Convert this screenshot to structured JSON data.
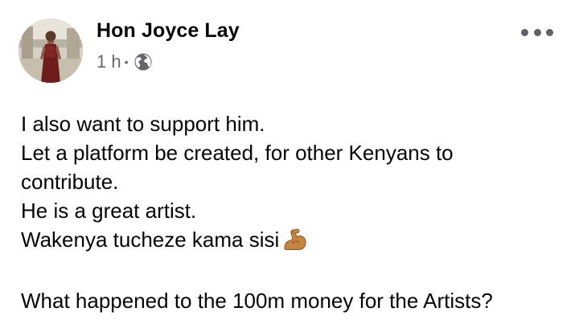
{
  "post": {
    "author": "Hon Joyce Lay",
    "time": "1 h",
    "separator": "•",
    "audience_icon": "globe-icon",
    "more_icon": "more-options-icon",
    "lines": [
      "I also want to support him.",
      "Let a platform be created, for other Kenyans to",
      "contribute.",
      "He is a great artist.",
      "Wakenya tucheze kama sisi"
    ],
    "emoji": "flexed-biceps-icon",
    "final_line": "What happened to the 100m money for the Artists?"
  },
  "colors": {
    "text": "#050505",
    "meta": "#65676b",
    "icon": "#5f6064",
    "background": "#ffffff"
  }
}
